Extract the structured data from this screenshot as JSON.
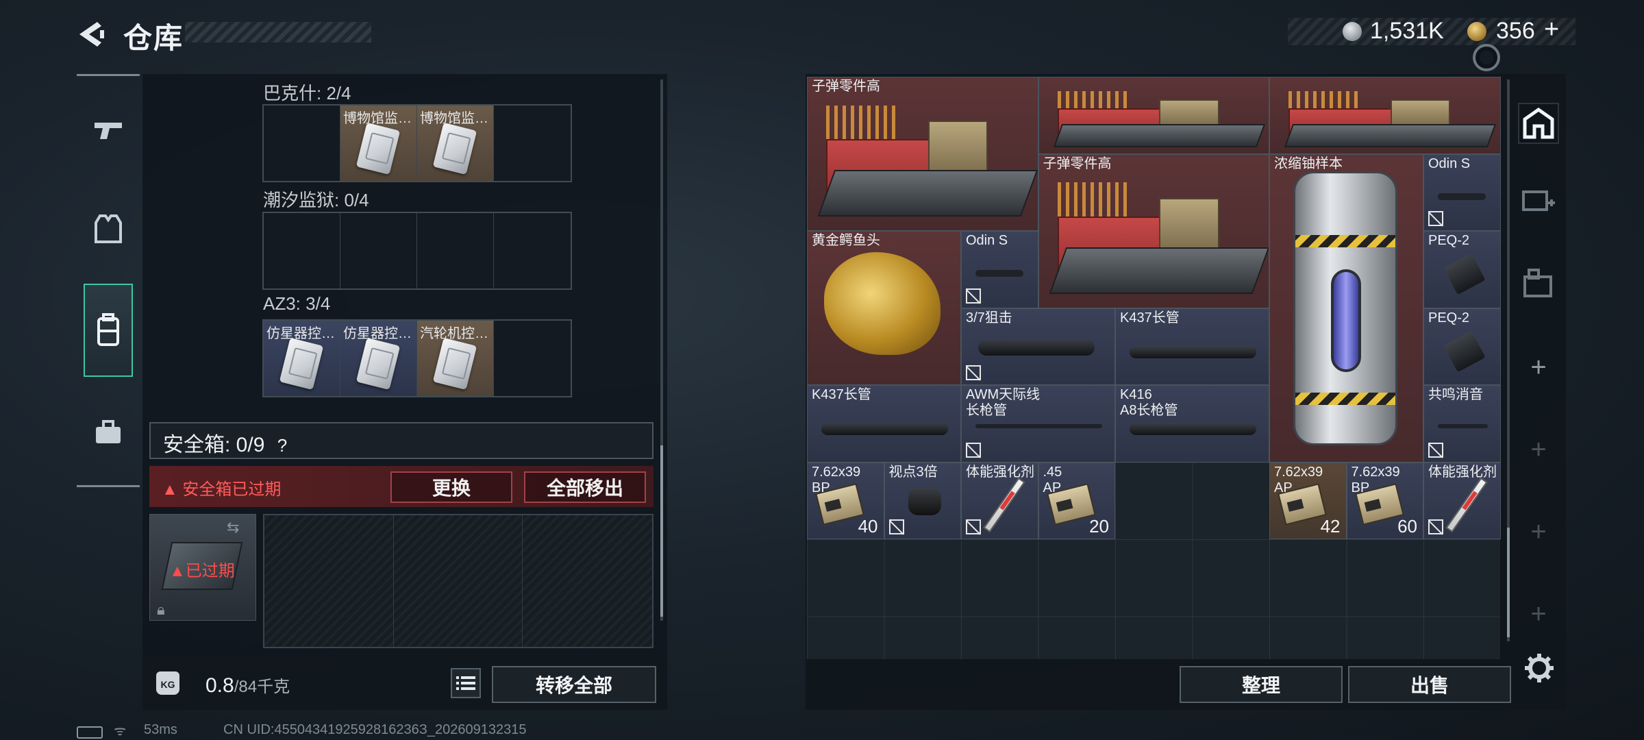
{
  "header": {
    "title": "仓库",
    "silver": "1,531K",
    "gold": "356",
    "gold_plus": "+"
  },
  "left": {
    "sections": [
      {
        "label": "巴克什: 2/4",
        "cells": [
          {
            "label": ""
          },
          {
            "label": "博物馆监…",
            "tone": "brown"
          },
          {
            "label": "博物馆监…",
            "tone": "brown"
          },
          {
            "label": ""
          }
        ]
      },
      {
        "label": "潮汐监狱: 0/4",
        "cells": [
          {
            "label": ""
          },
          {
            "label": ""
          },
          {
            "label": ""
          },
          {
            "label": ""
          }
        ]
      },
      {
        "label": "AZ3: 3/4",
        "cells": [
          {
            "label": "仿星器控…",
            "tone": "blue"
          },
          {
            "label": "仿星器控…",
            "tone": "blue"
          },
          {
            "label": "汽轮机控…",
            "tone": "brown"
          },
          {
            "label": ""
          }
        ]
      }
    ],
    "safebox": {
      "label": "安全箱: 0/9",
      "help": "?",
      "expired_banner": "安全箱已过期",
      "replace": "更换",
      "remove_all": "全部移出",
      "thumb_label": "已过期"
    },
    "weight": {
      "value": "0.8",
      "unit": "/84千克",
      "transfer_all": "转移全部",
      "kg": "KG"
    }
  },
  "stash": {
    "items": [
      {
        "label": "子弹零件高",
        "tone": "red",
        "art": "crate"
      },
      {
        "label": "",
        "tone": "red",
        "art": "crate"
      },
      {
        "label": "",
        "tone": "red",
        "art": "crate"
      },
      {
        "label": "子弹零件高",
        "tone": "red",
        "art": "crate"
      },
      {
        "label": "浓缩铀样本",
        "tone": "red",
        "art": "canister"
      },
      {
        "label": "Odin S",
        "tone": "blue",
        "art": "scope"
      },
      {
        "label": "黄金鳄鱼头",
        "tone": "red",
        "art": "croc"
      },
      {
        "label": "Odin S",
        "tone": "blue",
        "art": "scope"
      },
      {
        "label": "PEQ-2",
        "tone": "blue",
        "art": "laser"
      },
      {
        "label": "3/7狙击",
        "tone": "blue",
        "art": "bigscope"
      },
      {
        "label": "K437长管",
        "tone": "blue",
        "art": "barrel"
      },
      {
        "label": "PEQ-2",
        "tone": "blue",
        "art": "laser"
      },
      {
        "label": "K437长管",
        "tone": "blue",
        "art": "barrel"
      },
      {
        "label": "AWM天际线\n长枪管",
        "tone": "blue",
        "art": "thin"
      },
      {
        "label": "K416\nA8长枪管",
        "tone": "blue",
        "art": "barrel"
      },
      {
        "label": "共鸣消音",
        "tone": "blue",
        "art": "thin"
      },
      {
        "label": "7.62x39\nBP",
        "tone": "blue",
        "art": "ammo",
        "count": "40"
      },
      {
        "label": "视点3倍",
        "tone": "blue",
        "art": "optic"
      },
      {
        "label": "体能强化剂",
        "tone": "blue",
        "art": "syringe"
      },
      {
        "label": ".45\nAP",
        "tone": "blue",
        "art": "ammo",
        "count": "20"
      },
      {
        "label": "7.62x39\nAP",
        "tone": "brown",
        "art": "ammo",
        "count": "42"
      },
      {
        "label": "7.62x39\nBP",
        "tone": "blue",
        "art": "ammo",
        "count": "60"
      },
      {
        "label": "体能强化剂",
        "tone": "blue",
        "art": "syringe"
      }
    ],
    "sort": "整理",
    "sell": "出售"
  },
  "status": {
    "ping": "53ms",
    "uid": "CN UID:4550434192592816236З_202609132315"
  }
}
